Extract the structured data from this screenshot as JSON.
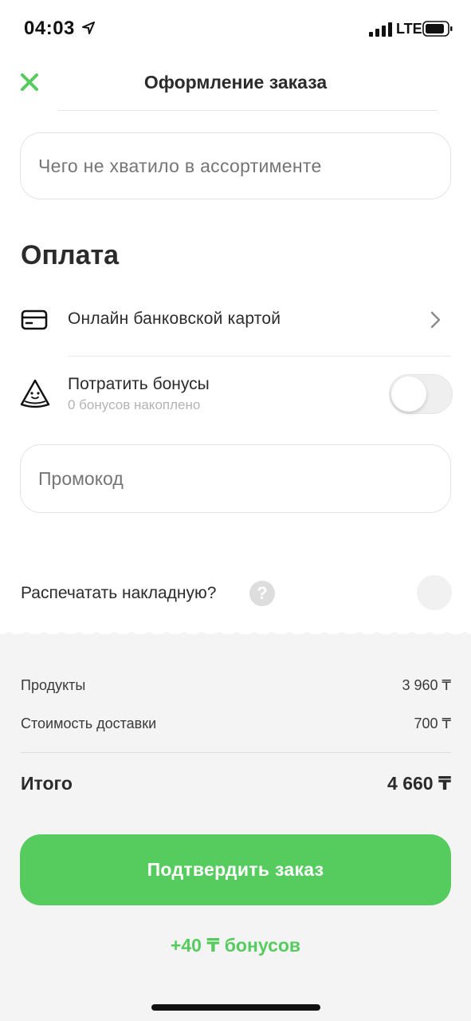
{
  "status_bar": {
    "time": "04:03",
    "network": "LTE",
    "icons": [
      "location-arrow-icon",
      "signal-bars-icon",
      "battery-icon"
    ]
  },
  "header": {
    "title": "Оформление заказа",
    "close_icon": "close-icon",
    "accent_color": "#56cb5e"
  },
  "missing_items": {
    "placeholder": "Чего не хватило в ассортименте"
  },
  "payment": {
    "section_title": "Оплата",
    "method_label": "Онлайн банковской картой",
    "method_icon": "credit-card-icon",
    "bonuses_label": "Потратить бонусы",
    "bonuses_sub": "0 бонусов накоплено",
    "bonuses_icon": "watermelon-slice-icon",
    "bonuses_enabled": false,
    "promo_placeholder": "Промокод"
  },
  "invoice": {
    "label": "Распечатать накладную?",
    "help_glyph": "?",
    "checked": false
  },
  "summary": {
    "products_label": "Продукты",
    "products_value": "3 960 ₸",
    "delivery_label": "Стоимость доставки",
    "delivery_value": "700 ₸",
    "total_label": "Итого",
    "total_value": "4 660 ₸"
  },
  "actions": {
    "confirm_label": "Подтвердить заказ",
    "bonus_earn": "+40 ₸ бонусов"
  }
}
